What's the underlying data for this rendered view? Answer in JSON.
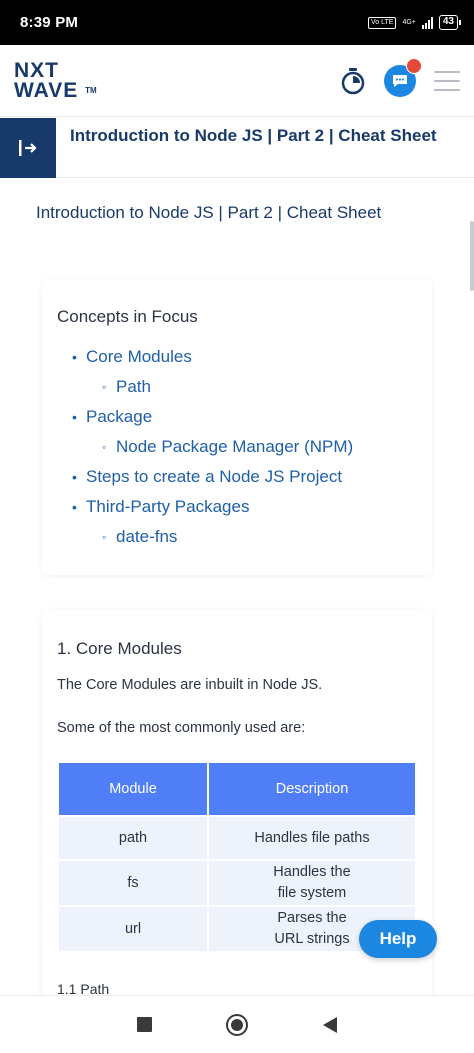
{
  "status_bar": {
    "time": "8:39 PM",
    "volte": "Vo LTE",
    "network": "4G+",
    "battery": "43"
  },
  "header": {
    "logo_line1": "NXT",
    "logo_line2": "WAVE",
    "logo_tm": "TM",
    "icons": [
      "timer-icon",
      "chat-icon",
      "menu-icon"
    ]
  },
  "title_bar": {
    "title": "Introduction to Node JS | Part 2 | Cheat Sheet"
  },
  "content": {
    "heading": "Introduction to Node JS | Part 2 | Cheat Sheet",
    "concepts": {
      "title": "Concepts in Focus",
      "items": [
        {
          "label": "Core Modules",
          "level": 1
        },
        {
          "label": "Path",
          "level": 2
        },
        {
          "label": "Package",
          "level": 1
        },
        {
          "label": "Node Package Manager (NPM)",
          "level": 2
        },
        {
          "label": "Steps to create a Node JS Project",
          "level": 1
        },
        {
          "label": "Third-Party Packages",
          "level": 1
        },
        {
          "label": "date-fns",
          "level": 2
        }
      ]
    },
    "section1": {
      "title": "1. Core Modules",
      "para1": "The Core Modules are inbuilt in Node JS.",
      "para2": "Some of the most commonly used are:",
      "table": {
        "headers": [
          "Module",
          "Description"
        ],
        "rows": [
          [
            "path",
            "Handles file paths"
          ],
          [
            "fs",
            "Handles the file system"
          ],
          [
            "url",
            "Parses the URL strings"
          ]
        ]
      },
      "sub_heading": "1.1 Path"
    },
    "help_label": "Help"
  },
  "colors": {
    "brand_navy": "#183a6b",
    "link_blue": "#1e5fa8",
    "table_header": "#4f7ef7",
    "help_button": "#1c87e0",
    "notification_dot": "#e34a3a"
  }
}
